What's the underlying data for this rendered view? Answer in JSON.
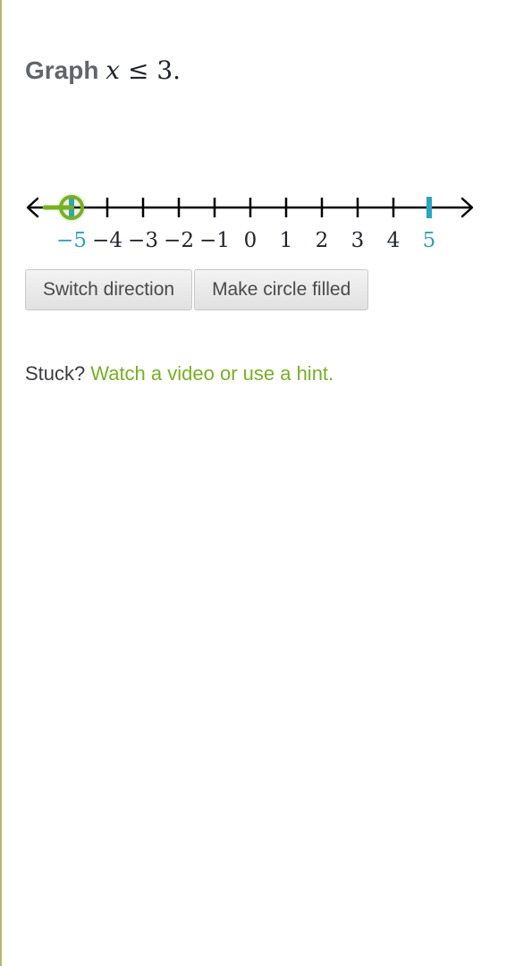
{
  "question": {
    "prefix": "Graph",
    "variable": "x",
    "operator": "≤",
    "value": "3."
  },
  "number_line": {
    "min": -5,
    "max": 5,
    "ticks": [
      -5,
      -4,
      -3,
      -2,
      -1,
      0,
      1,
      2,
      3,
      4,
      5
    ],
    "tick_labels": [
      "−5",
      "−4",
      "−3",
      "−2",
      "−1",
      "0",
      "1",
      "2",
      "3",
      "4",
      "5"
    ],
    "highlighted_labels": [
      -5,
      5
    ],
    "point_value": -5,
    "point_style": "open",
    "ray_direction": "left",
    "colors": {
      "axis": "#000000",
      "endpoint_marker": "#29a5bf",
      "point": "#78b024",
      "highlight_label": "#2e9fc0"
    }
  },
  "buttons": {
    "switch_direction": "Switch direction",
    "make_circle_filled": "Make circle filled"
  },
  "help": {
    "stuck_label": "Stuck?",
    "hint_link": "Watch a video or use a hint."
  }
}
